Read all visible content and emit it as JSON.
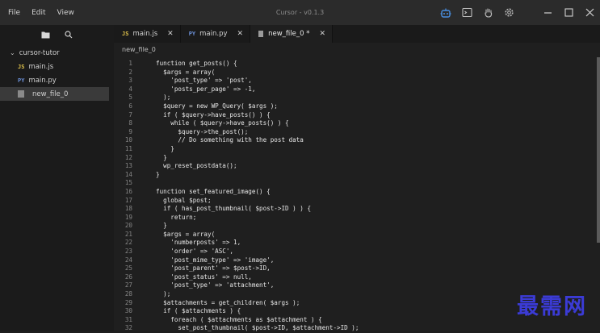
{
  "menu": [
    "File",
    "Edit",
    "View"
  ],
  "window_title": "Cursor - v0.1.3",
  "sidebar": {
    "folder": "cursor-tutor",
    "files": [
      {
        "name": "main.js",
        "badge": "JS"
      },
      {
        "name": "main.py",
        "badge": "PY"
      },
      {
        "name": "new_file_0",
        "badge": ""
      }
    ]
  },
  "tabs": [
    {
      "badge": "JS",
      "label": "main.js"
    },
    {
      "badge": "PY",
      "label": "main.py"
    },
    {
      "badge": "",
      "label": "new_file_0 *"
    }
  ],
  "breadcrumb": "new_file_0",
  "code_lines": [
    "function get_posts() {",
    "  $args = array(",
    "    'post_type' => 'post',",
    "    'posts_per_page' => -1,",
    "  );",
    "  $query = new WP_Query( $args );",
    "  if ( $query->have_posts() ) {",
    "    while ( $query->have_posts() ) {",
    "      $query->the_post();",
    "      // Do something with the post data",
    "    }",
    "  }",
    "  wp_reset_postdata();",
    "}",
    "",
    "function set_featured_image() {",
    "  global $post;",
    "  if ( has_post_thumbnail( $post->ID ) ) {",
    "    return;",
    "  }",
    "  $args = array(",
    "    'numberposts' => 1,",
    "    'order' => 'ASC',",
    "    'post_mime_type' => 'image',",
    "    'post_parent' => $post->ID,",
    "    'post_status' => null,",
    "    'post_type' => 'attachment',",
    "  );",
    "  $attachments = get_children( $args );",
    "  if ( $attachments ) {",
    "    foreach ( $attachments as $attachment ) {",
    "      set_post_thumbnail( $post->ID, $attachment->ID );"
  ],
  "watermark": "最需网",
  "colors": {
    "titlebar": "#2b2b2b",
    "sidebar": "#1b1b1b",
    "editor": "#1f1f1f",
    "js_badge": "#e0c34c",
    "py_badge": "#6b8fd6",
    "accent_icon": "#4a90e2"
  }
}
